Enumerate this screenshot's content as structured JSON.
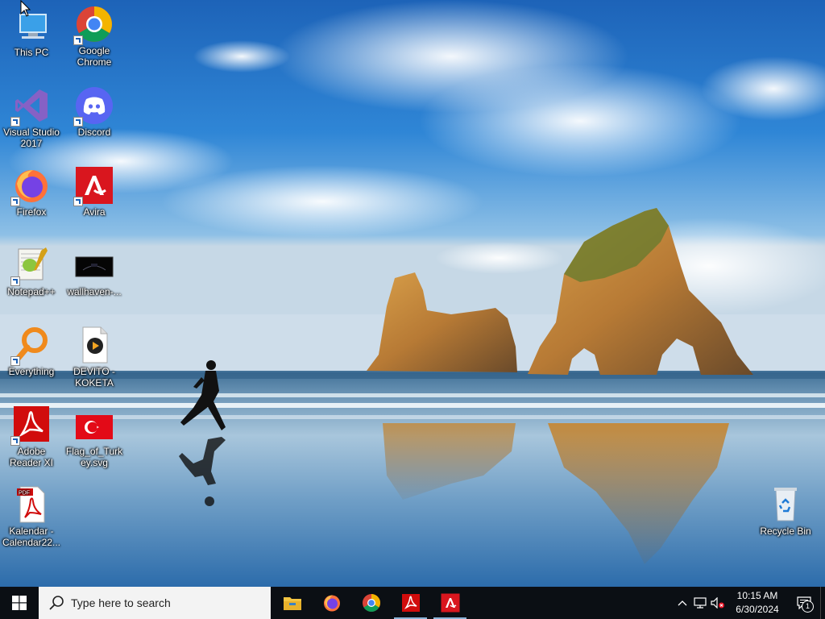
{
  "desktop": {
    "icons": [
      {
        "id": "this-pc",
        "label": "This PC"
      },
      {
        "id": "google-chrome",
        "label": "Google Chrome"
      },
      {
        "id": "visual-studio",
        "label": "Visual Studio 2017"
      },
      {
        "id": "discord",
        "label": "Discord"
      },
      {
        "id": "firefox",
        "label": "Firefox"
      },
      {
        "id": "avira",
        "label": "Avira"
      },
      {
        "id": "notepadpp",
        "label": "Notepad++"
      },
      {
        "id": "wallhaven",
        "label": "wallhaven-..."
      },
      {
        "id": "everything",
        "label": "Everything"
      },
      {
        "id": "devito",
        "label": "DEVITO - KOKETA"
      },
      {
        "id": "adobe-reader",
        "label": "Adobe Reader XI"
      },
      {
        "id": "flag-turkey",
        "label": "Flag_of_Turkey.svg"
      },
      {
        "id": "kalendar",
        "label": "Kalendar - Calendar22..."
      },
      {
        "id": "recycle-bin",
        "label": "Recycle Bin"
      }
    ]
  },
  "taskbar": {
    "search_placeholder": "Type here to search",
    "pinned": [
      "file-explorer",
      "firefox",
      "chrome",
      "adobe-reader",
      "avira"
    ],
    "clock": {
      "time": "10:15 AM",
      "date": "6/30/2024"
    },
    "notification_count": "1"
  },
  "colors": {
    "taskbar_bg": "#0b0f14",
    "search_bg": "#f3f3f3",
    "running_indicator": "#8ab4d8"
  }
}
